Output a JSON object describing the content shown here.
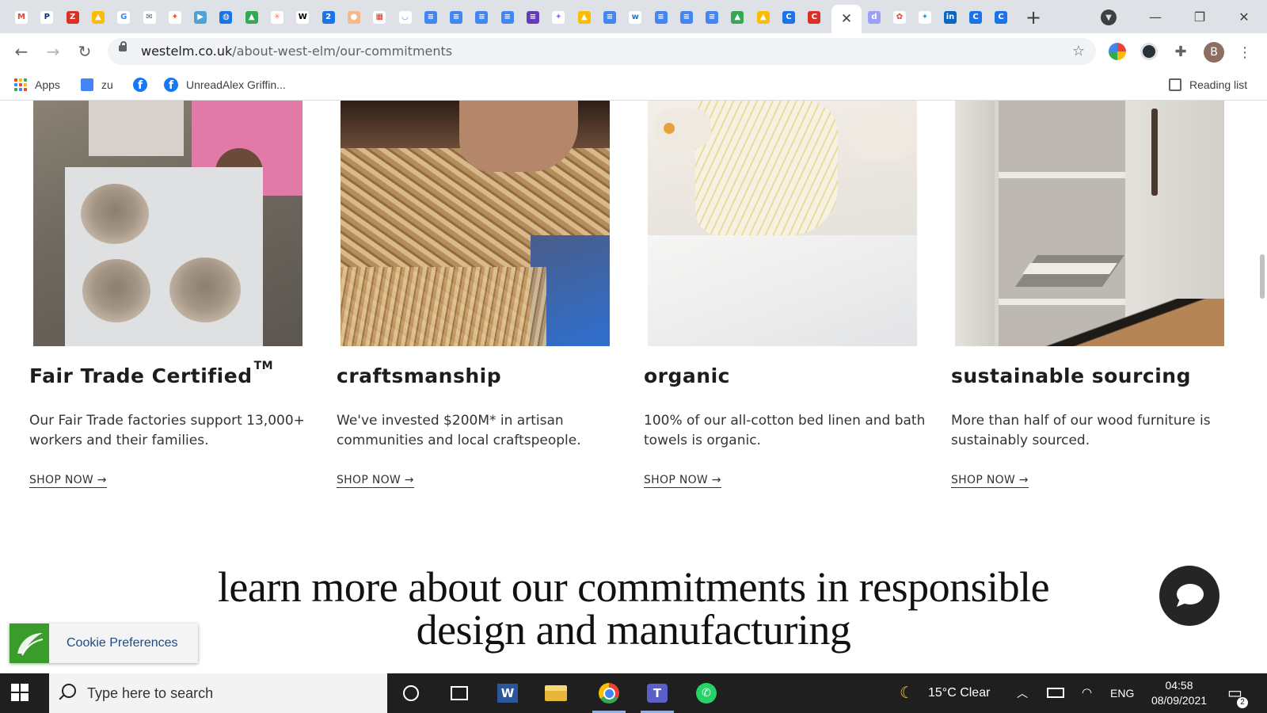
{
  "browser": {
    "favicons": [
      {
        "icon": "gmail-icon",
        "color": "#ffffff",
        "fg": "#ea4335",
        "glyph": "M"
      },
      {
        "icon": "paypal-icon",
        "color": "#ffffff",
        "fg": "#003087",
        "glyph": "P"
      },
      {
        "icon": "zoho-icon",
        "color": "#d93025",
        "fg": "#ffffff",
        "glyph": "Z"
      },
      {
        "icon": "google-drive-icon",
        "color": "#fbbc04",
        "fg": "#ffffff",
        "glyph": "▲"
      },
      {
        "icon": "google-icon",
        "color": "#ffffff",
        "fg": "#4285f4",
        "glyph": "G"
      },
      {
        "icon": "mail-icon",
        "color": "#ffffff",
        "fg": "#5f6368",
        "glyph": "✉"
      },
      {
        "icon": "figma-icon",
        "color": "#ffffff",
        "fg": "#f24e1e",
        "glyph": "✦"
      },
      {
        "icon": "play-icon",
        "color": "#4fa3d1",
        "fg": "#ffffff",
        "glyph": "▶"
      },
      {
        "icon": "globe-icon",
        "color": "#1a73e8",
        "fg": "#ffffff",
        "glyph": "◍"
      },
      {
        "icon": "google-drive-icon",
        "color": "#34a853",
        "fg": "#ffffff",
        "glyph": "▲"
      },
      {
        "icon": "hubspot-icon",
        "color": "#ffffff",
        "fg": "#ff7a59",
        "glyph": "✳"
      },
      {
        "icon": "wix-icon",
        "color": "#ffffff",
        "fg": "#000000",
        "glyph": "W"
      },
      {
        "icon": "calendar-2-icon",
        "color": "#1a73e8",
        "fg": "#ffffff",
        "glyph": "2"
      },
      {
        "icon": "orange-ball-icon",
        "color": "#f7b98a",
        "fg": "#ffffff",
        "glyph": "●"
      },
      {
        "icon": "calendar-18-icon",
        "color": "#ffffff",
        "fg": "#d93025",
        "glyph": "▦"
      },
      {
        "icon": "clickup-icon",
        "color": "#ffffff",
        "fg": "#7b68ee",
        "glyph": "◡"
      },
      {
        "icon": "google-docs-icon",
        "color": "#4285f4",
        "fg": "#ffffff",
        "glyph": "≡"
      },
      {
        "icon": "google-docs-icon",
        "color": "#4285f4",
        "fg": "#ffffff",
        "glyph": "≡"
      },
      {
        "icon": "google-docs-icon",
        "color": "#4285f4",
        "fg": "#ffffff",
        "glyph": "≡"
      },
      {
        "icon": "google-docs-icon",
        "color": "#4285f4",
        "fg": "#ffffff",
        "glyph": "≡"
      },
      {
        "icon": "google-forms-icon",
        "color": "#673ab7",
        "fg": "#ffffff",
        "glyph": "≡"
      },
      {
        "icon": "figma-icon",
        "color": "#ffffff",
        "fg": "#a259ff",
        "glyph": "✦"
      },
      {
        "icon": "google-drive-icon",
        "color": "#fbbc04",
        "fg": "#ffffff",
        "glyph": "▲"
      },
      {
        "icon": "google-docs-icon",
        "color": "#4285f4",
        "fg": "#ffffff",
        "glyph": "≡"
      },
      {
        "icon": "w-icon",
        "color": "#ffffff",
        "fg": "#1a73e8",
        "glyph": "w"
      },
      {
        "icon": "google-docs-icon",
        "color": "#4285f4",
        "fg": "#ffffff",
        "glyph": "≡"
      },
      {
        "icon": "google-docs-icon",
        "color": "#4285f4",
        "fg": "#ffffff",
        "glyph": "≡"
      },
      {
        "icon": "google-docs-icon",
        "color": "#4285f4",
        "fg": "#ffffff",
        "glyph": "≡"
      },
      {
        "icon": "google-drive-icon",
        "color": "#34a853",
        "fg": "#ffffff",
        "glyph": "▲"
      },
      {
        "icon": "google-drive-icon",
        "color": "#fbbc04",
        "fg": "#ffffff",
        "glyph": "▲"
      },
      {
        "icon": "circle-c-icon",
        "color": "#1a73e8",
        "fg": "#ffffff",
        "glyph": "C"
      },
      {
        "icon": "red-c-icon",
        "color": "#d93025",
        "fg": "#ffffff",
        "glyph": "C"
      }
    ],
    "favicons_right": [
      {
        "icon": "d-icon",
        "color": "#9aa0f8",
        "fg": "#ffffff",
        "glyph": "d"
      },
      {
        "icon": "bird-icon",
        "color": "#ffffff",
        "fg": "#e53935",
        "glyph": "✿"
      },
      {
        "icon": "twitter-icon",
        "color": "#ffffff",
        "fg": "#1da1f2",
        "glyph": "✦"
      },
      {
        "icon": "linkedin-icon",
        "color": "#0a66c2",
        "fg": "#ffffff",
        "glyph": "in"
      },
      {
        "icon": "circle-c-icon",
        "color": "#1a73e8",
        "fg": "#ffffff",
        "glyph": "C"
      },
      {
        "icon": "circle-c-icon",
        "color": "#1a73e8",
        "fg": "#ffffff",
        "glyph": "C"
      }
    ],
    "active_tab_close": "✕",
    "new_tab": "+",
    "window_controls": {
      "minimize": "—",
      "restore": "❐",
      "close": "✕"
    },
    "url_host": "westelm.co.uk",
    "url_path": "/about-west-elm/our-commitments",
    "bookmarks": {
      "apps": "Apps",
      "zu": "zu",
      "fb_glyph": "f",
      "unread": "UnreadAlex Griffin...",
      "reading_list": "Reading list"
    },
    "profile_initial": "B"
  },
  "page": {
    "cards": [
      {
        "title": "Fair Trade Certified",
        "title_sup": "TM",
        "desc": "Our Fair Trade factories support 13,000+ workers and their families.",
        "cta": "SHOP NOW →"
      },
      {
        "title": "craftsmanship",
        "title_sup": "",
        "desc": "We've invested $200M* in artisan communities and local craftspeople.",
        "cta": "SHOP NOW →"
      },
      {
        "title": "organic",
        "title_sup": "",
        "desc": "100% of our all-cotton bed linen and bath towels is organic.",
        "cta": "SHOP NOW →"
      },
      {
        "title": "sustainable sourcing",
        "title_sup": "",
        "desc": "More than half of our wood furniture is sustainably sourced.",
        "cta": "SHOP NOW →"
      }
    ],
    "heading_line1": "learn more about our commitments in responsible",
    "heading_line2": "design and manufacturing",
    "cookie_label": "Cookie Preferences"
  },
  "taskbar": {
    "search_placeholder": "Type here to search",
    "weather": "15°C  Clear",
    "language": "ENG",
    "time": "04:58",
    "date": "08/09/2021",
    "notification_count": "2"
  }
}
